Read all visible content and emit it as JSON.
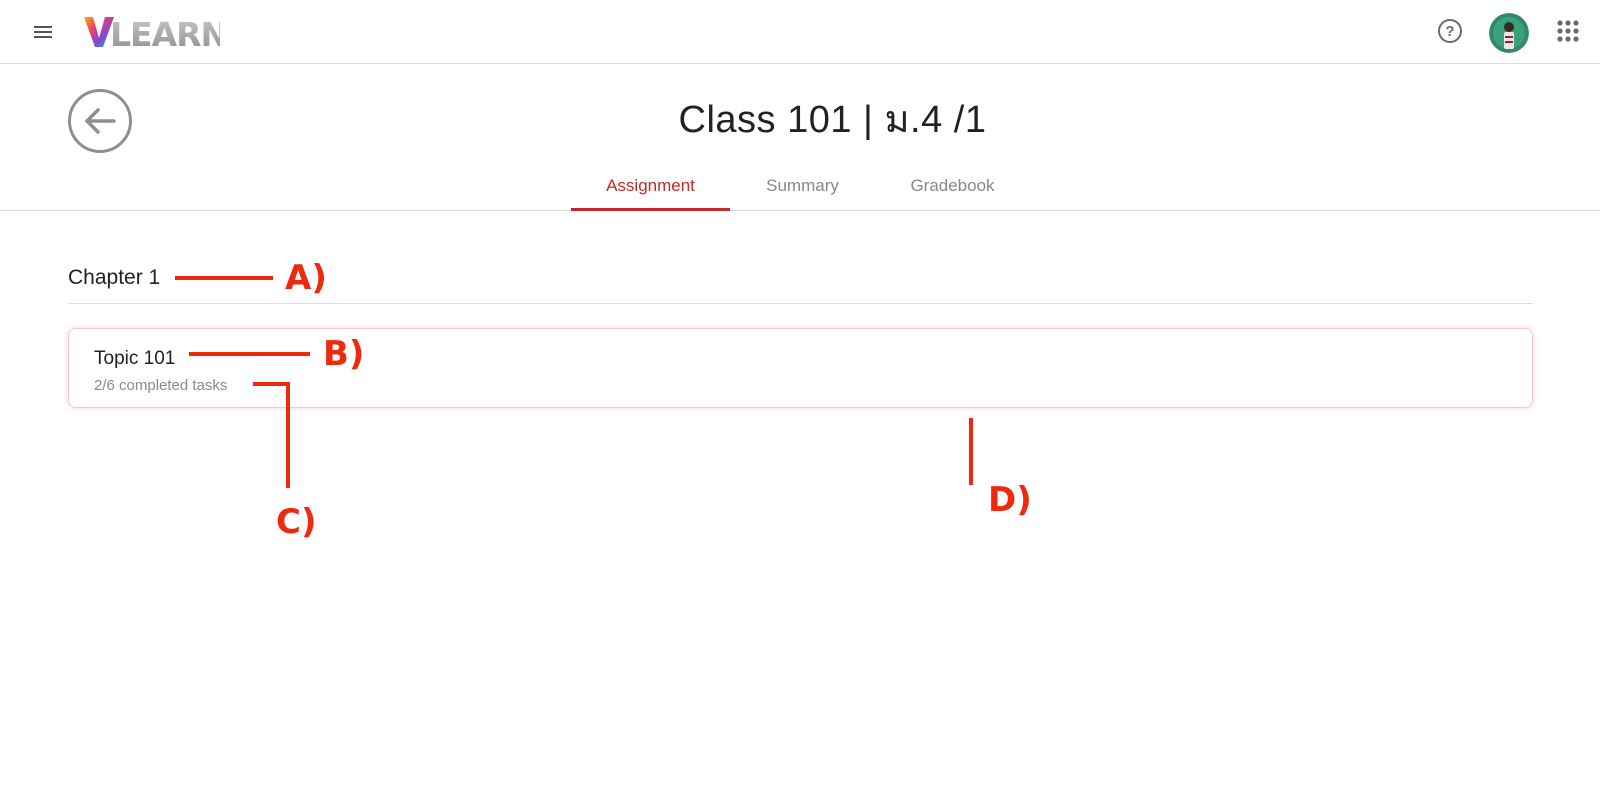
{
  "app": {
    "logo_text": "VLEARN"
  },
  "header": {
    "title": "Class 101 | ม.4 /1"
  },
  "tabs": [
    {
      "label": "Assignment",
      "active": true
    },
    {
      "label": "Summary",
      "active": false
    },
    {
      "label": "Gradebook",
      "active": false
    }
  ],
  "chapter": {
    "title": "Chapter 1",
    "topics": [
      {
        "title": "Topic 101",
        "progress": "2/6 completed tasks"
      }
    ]
  },
  "annotations": {
    "a": "A)",
    "b": "B)",
    "c": "C)",
    "d": "D)"
  },
  "colors": {
    "accent": "#c62828",
    "annotation": "#ee2a0d"
  }
}
